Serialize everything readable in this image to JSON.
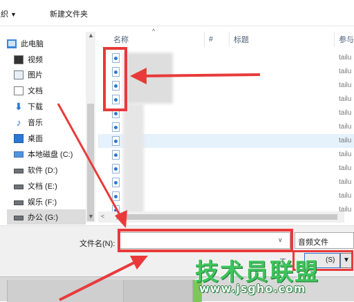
{
  "toolbar": {
    "organize_label": "组织",
    "new_folder_label": "新建文件夹"
  },
  "nav": {
    "items": [
      {
        "label": "此电脑",
        "icon": "computer-icon"
      },
      {
        "label": "视频",
        "icon": "video-icon"
      },
      {
        "label": "图片",
        "icon": "picture-icon"
      },
      {
        "label": "文档",
        "icon": "document-icon"
      },
      {
        "label": "下载",
        "icon": "download-icon"
      },
      {
        "label": "音乐",
        "icon": "music-icon"
      },
      {
        "label": "桌面",
        "icon": "desktop-icon"
      },
      {
        "label": "本地磁盘 (C:)",
        "icon": "system-drive-icon"
      },
      {
        "label": "软件 (D:)",
        "icon": "drive-icon"
      },
      {
        "label": "文档 (E:)",
        "icon": "drive-icon"
      },
      {
        "label": "娱乐 (F:)",
        "icon": "drive-icon"
      },
      {
        "label": "办公 (G:)",
        "icon": "drive-icon",
        "selected": true
      }
    ]
  },
  "list": {
    "columns": {
      "name": "名称",
      "number": "#",
      "title": "标题",
      "participant": "参与"
    },
    "rows": [
      {
        "artist": "tailu"
      },
      {
        "artist": "tailu"
      },
      {
        "artist": "tailu"
      },
      {
        "artist": "tailu"
      },
      {
        "artist": "tailu"
      },
      {
        "artist": "tailu",
        "selected": true
      },
      {
        "artist": "tailu"
      },
      {
        "artist": "tailu"
      },
      {
        "artist": "tailu"
      },
      {
        "artist": "tailu"
      },
      {
        "artist": "tailu"
      },
      {
        "artist": "tailu"
      }
    ]
  },
  "bottom": {
    "filename_label": "文件名(N):",
    "filename_value": "",
    "filetype_value": "音频文件",
    "tools_prefix": "工",
    "tools_label": "(S)"
  },
  "watermark": {
    "title": "技术员联盟",
    "url": "www.jsgho.com"
  },
  "colors": {
    "annotation_red": "#e83a3a",
    "selection_blue": "#e5f1fb",
    "watermark_green": "#3ec45c"
  }
}
